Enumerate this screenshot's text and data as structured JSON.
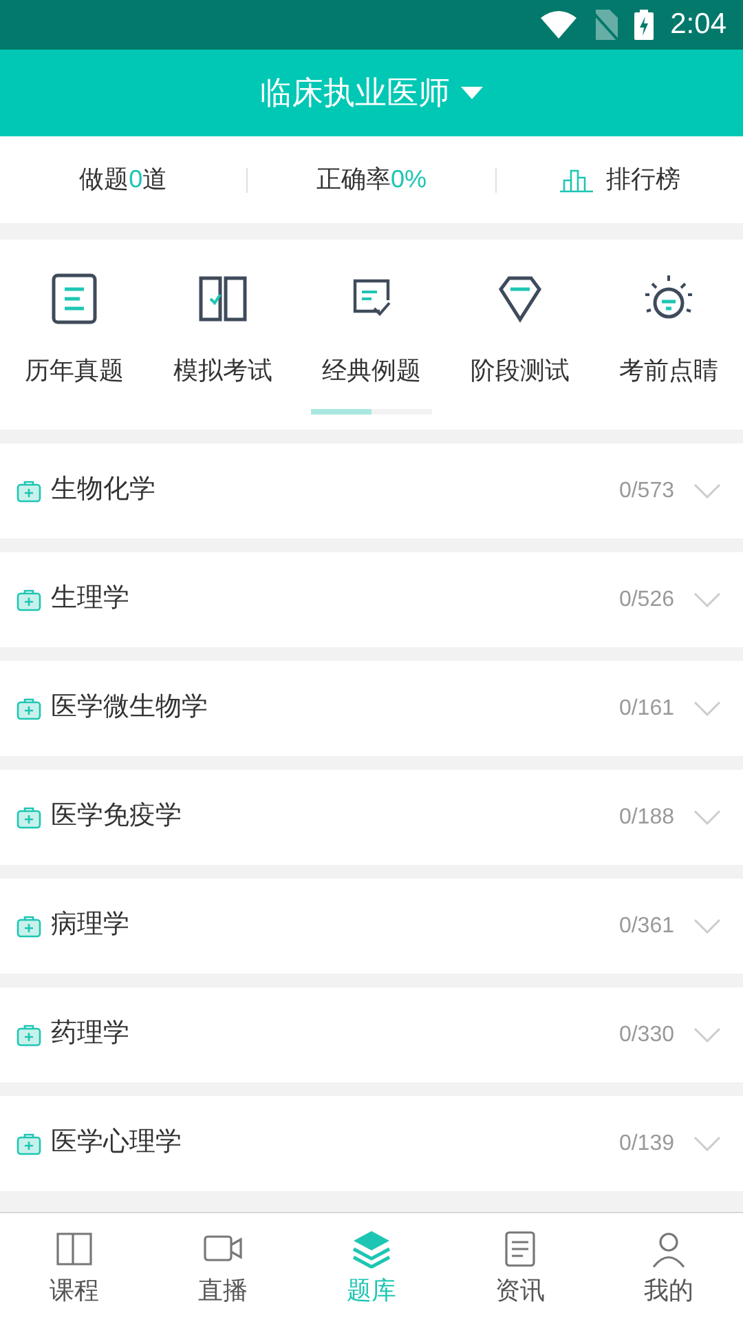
{
  "status_bar": {
    "time": "2:04"
  },
  "header": {
    "title": "临床执业医师"
  },
  "stats": {
    "done": "做题**0**道",
    "accuracy": "正确率**0%**",
    "ranking": "排行榜"
  },
  "categories": [
    {
      "kind": "paper",
      "label": "历年真题"
    },
    {
      "kind": "book",
      "label": "模拟考试"
    },
    {
      "kind": "check",
      "label": "经典例题"
    },
    {
      "kind": "gem",
      "label": "阶段测试"
    },
    {
      "kind": "bulb",
      "label": "考前点睛"
    }
  ],
  "subjects": [
    {
      "name": "生物化学",
      "progress": "0/573"
    },
    {
      "name": "生理学",
      "progress": "0/526"
    },
    {
      "name": "医学微生物学",
      "progress": "0/161"
    },
    {
      "name": "医学免疫学",
      "progress": "0/188"
    },
    {
      "name": "病理学",
      "progress": "0/361"
    },
    {
      "name": "药理学",
      "progress": "0/330"
    },
    {
      "name": "医学心理学",
      "progress": "0/139"
    }
  ],
  "bottom_nav": [
    {
      "kind": "book",
      "label": "课程",
      "selected": false
    },
    {
      "kind": "video",
      "label": "直播",
      "selected": false
    },
    {
      "kind": "layers",
      "label": "题库",
      "selected": true
    },
    {
      "kind": "news",
      "label": "资讯",
      "selected": false
    },
    {
      "kind": "person",
      "label": "我的",
      "selected": false
    }
  ]
}
